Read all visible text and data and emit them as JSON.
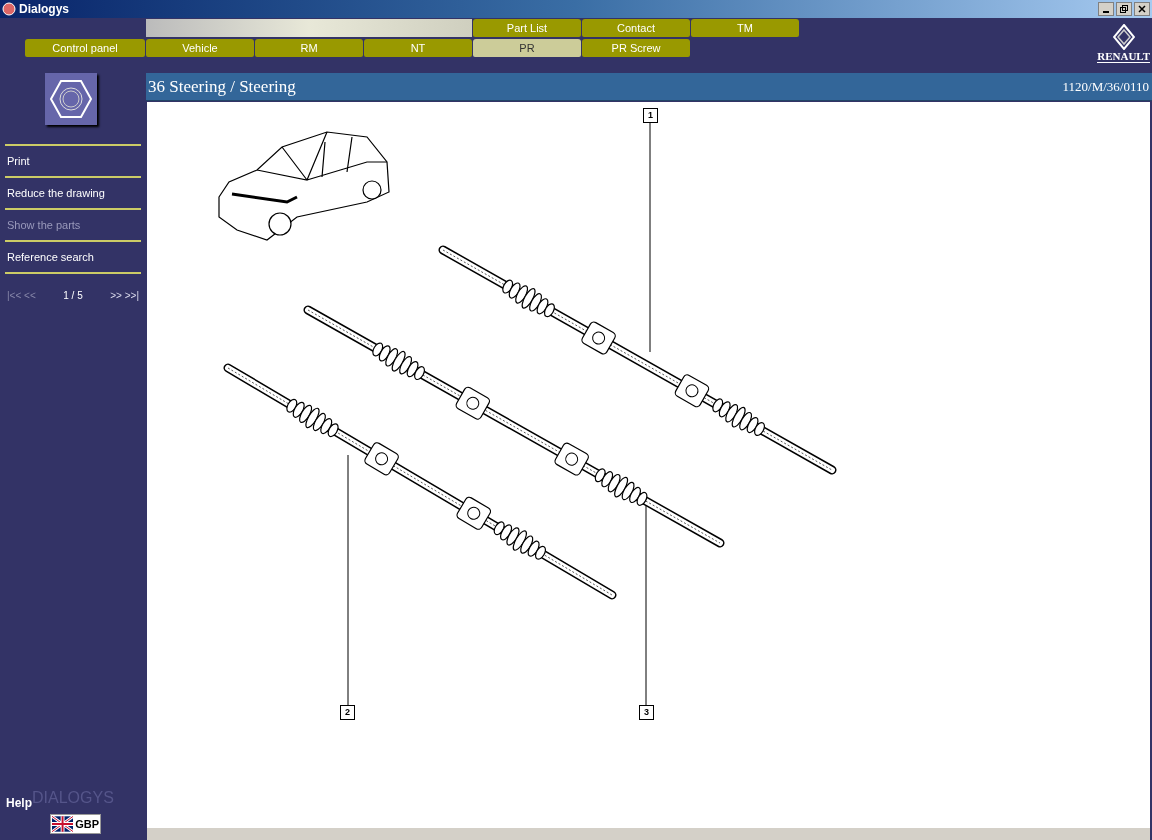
{
  "window": {
    "title": "Dialogys"
  },
  "tabs_top": [
    {
      "label": "Part List",
      "selected": false
    },
    {
      "label": "Contact",
      "selected": false
    },
    {
      "label": "TM",
      "selected": false
    }
  ],
  "tabs_bottom": [
    {
      "label": "Control panel",
      "selected": false
    },
    {
      "label": "Vehicle",
      "selected": false
    },
    {
      "label": "RM",
      "selected": false
    },
    {
      "label": "NT",
      "selected": false
    },
    {
      "label": "PR",
      "selected": true
    },
    {
      "label": "PR Screw",
      "selected": false
    }
  ],
  "brand_logo": {
    "text": "RENAULT"
  },
  "header": {
    "title": "36 Steering / Steering",
    "reference": "1120/M/36/0110"
  },
  "sidebar": {
    "items": [
      {
        "label": "Print",
        "disabled": false
      },
      {
        "label": "Reduce the drawing",
        "disabled": false
      },
      {
        "label": "Show the parts",
        "disabled": true
      },
      {
        "label": "Reference search",
        "disabled": false
      }
    ],
    "pager": {
      "first": {
        "label": "|<< <<",
        "disabled": true
      },
      "page": "1 / 5",
      "last": {
        "label": ">> >>|",
        "disabled": false
      }
    },
    "help": "Help",
    "product_name": "DIALOGYS",
    "currency": "GBP"
  },
  "drawing": {
    "callouts": [
      "1",
      "2",
      "3"
    ]
  }
}
